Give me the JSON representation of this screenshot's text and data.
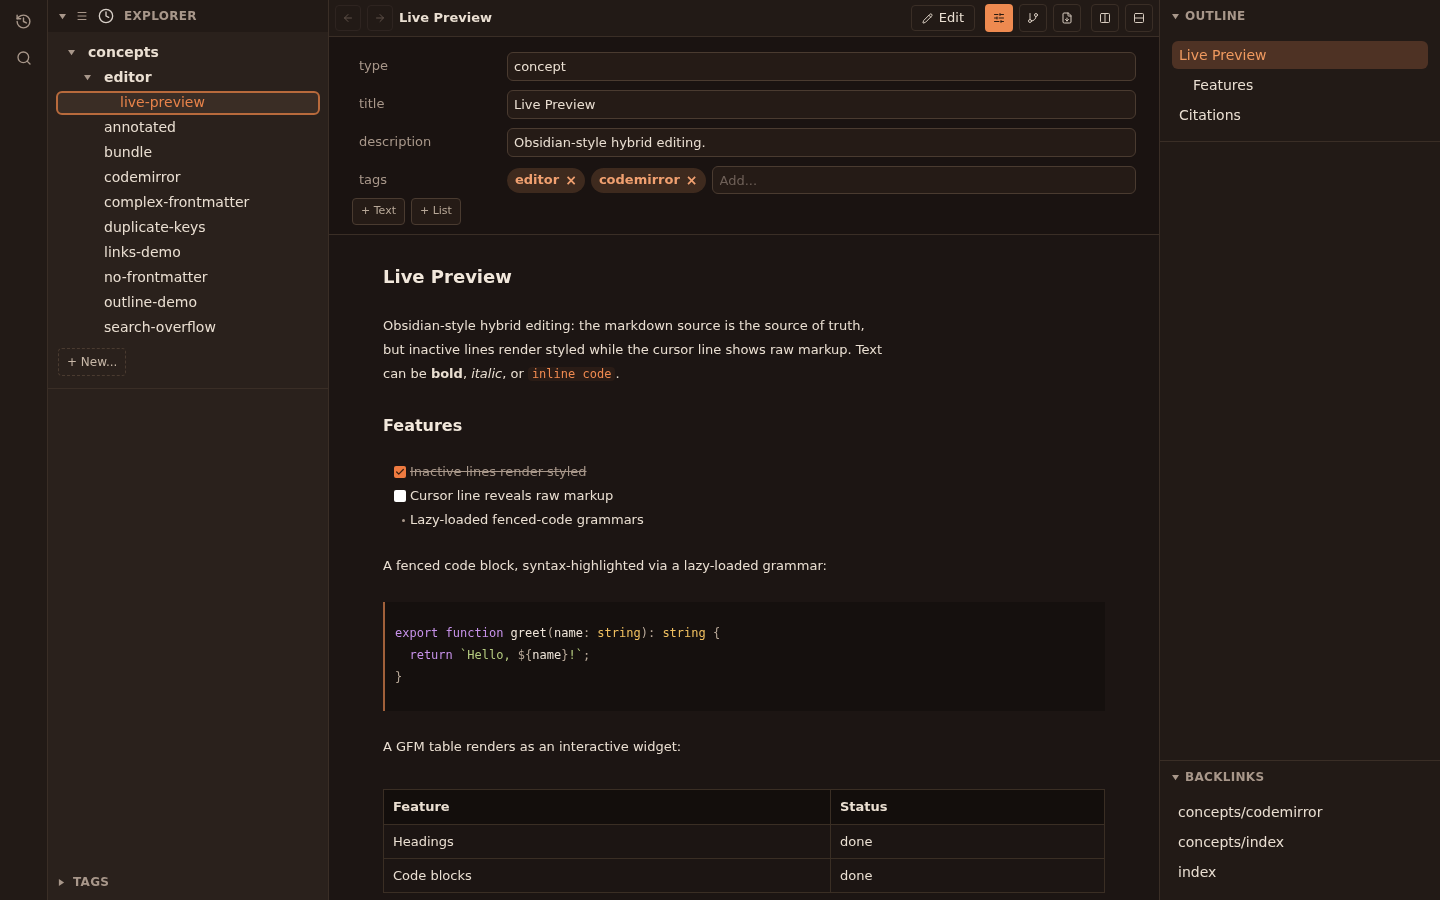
{
  "explorer": {
    "title": "EXPLORER",
    "tree": [
      {
        "label": "concepts",
        "expanded": true,
        "selected": false,
        "children": [
          {
            "label": "editor",
            "expanded": true,
            "selected": false,
            "children": [
              {
                "label": "live-preview",
                "selected": true
              }
            ]
          },
          {
            "label": "annotated",
            "selected": false
          },
          {
            "label": "bundle",
            "selected": false
          },
          {
            "label": "codemirror",
            "selected": false
          },
          {
            "label": "complex-frontmatter",
            "selected": false
          },
          {
            "label": "duplicate-keys",
            "selected": false
          },
          {
            "label": "links-demo",
            "selected": false
          },
          {
            "label": "no-frontmatter",
            "selected": false
          },
          {
            "label": "outline-demo",
            "selected": false
          },
          {
            "label": "search-overflow",
            "selected": false
          }
        ]
      }
    ],
    "new_button": "+ New...",
    "tags_section": {
      "title": "TAGS",
      "expanded": false
    }
  },
  "toolbar": {
    "title": "Live Preview",
    "edit_button": "Edit",
    "icons": [
      {
        "kind": "sliders",
        "selected": true
      },
      {
        "kind": "branch",
        "selected": false
      },
      {
        "kind": "file",
        "selected": false
      },
      {
        "kind": "columns",
        "selected": false
      },
      {
        "kind": "rows",
        "selected": false
      }
    ]
  },
  "properties": {
    "rows": [
      {
        "key": "type",
        "kind": "text",
        "value": "concept"
      },
      {
        "key": "title",
        "kind": "text",
        "value": "Live Preview"
      },
      {
        "key": "description",
        "kind": "text",
        "value": "Obsidian-style hybrid editing."
      },
      {
        "key": "tags",
        "kind": "tags",
        "tags": [
          "editor",
          "codemirror"
        ],
        "remove": "×",
        "placeholder": "Add..."
      }
    ],
    "add_buttons": [
      "+ Text",
      "+ List"
    ]
  },
  "document": {
    "title": "Live Preview",
    "intro": {
      "text": "Obsidian-style hybrid editing: the markdown source is the source of truth, but inactive lines render styled while the cursor line shows raw markup. Text can be **bold**, *italic*, or ",
      "code": "inline code",
      "after": "."
    },
    "features_heading": "Features",
    "list": [
      {
        "kind": "task",
        "checked": true,
        "text": "Inactive lines render styled"
      },
      {
        "kind": "task",
        "checked": false,
        "text": "Cursor line reveals raw markup"
      },
      {
        "kind": "bullet",
        "text": "Lazy-loaded fenced-code grammars"
      }
    ],
    "code_intro": "A fenced code block, syntax-highlighted via a lazy-loaded grammar:",
    "code": [
      [
        {
          "kind": "keyword",
          "s": "export function"
        },
        {
          "kind": "name",
          "s": " greet"
        },
        {
          "kind": "punct",
          "s": "("
        },
        {
          "kind": "name",
          "s": "name"
        },
        {
          "kind": "punct",
          "s": ": "
        },
        {
          "kind": "type",
          "s": "string"
        },
        {
          "kind": "punct",
          "s": "): "
        },
        {
          "kind": "type",
          "s": "string"
        },
        {
          "kind": "punct",
          "s": " {"
        }
      ],
      [
        {
          "kind": "keyword",
          "s": "  return "
        },
        {
          "kind": "string",
          "s": "`Hello, "
        },
        {
          "kind": "punct",
          "s": "${"
        },
        {
          "kind": "name",
          "s": "name"
        },
        {
          "kind": "punct",
          "s": "}"
        },
        {
          "kind": "string",
          "s": "!`"
        },
        {
          "kind": "punct",
          "s": ";"
        }
      ],
      [
        {
          "kind": "punct",
          "s": "}"
        }
      ]
    ],
    "table_intro": "A GFM table renders as an interactive widget:",
    "table": {
      "columns": [
        "Feature",
        "Status"
      ],
      "rows": [
        [
          "Headings",
          "done"
        ],
        [
          "Code blocks",
          "done"
        ]
      ]
    }
  },
  "outline": {
    "title": "OUTLINE",
    "items": [
      {
        "label": "Live Preview",
        "selected": true,
        "children": [
          {
            "label": "Features",
            "selected": false
          }
        ]
      },
      {
        "label": "Citations",
        "selected": false
      }
    ]
  },
  "backlinks": {
    "title": "BACKLINKS",
    "items": [
      "concepts/codemirror",
      "concepts/index",
      "index"
    ]
  }
}
